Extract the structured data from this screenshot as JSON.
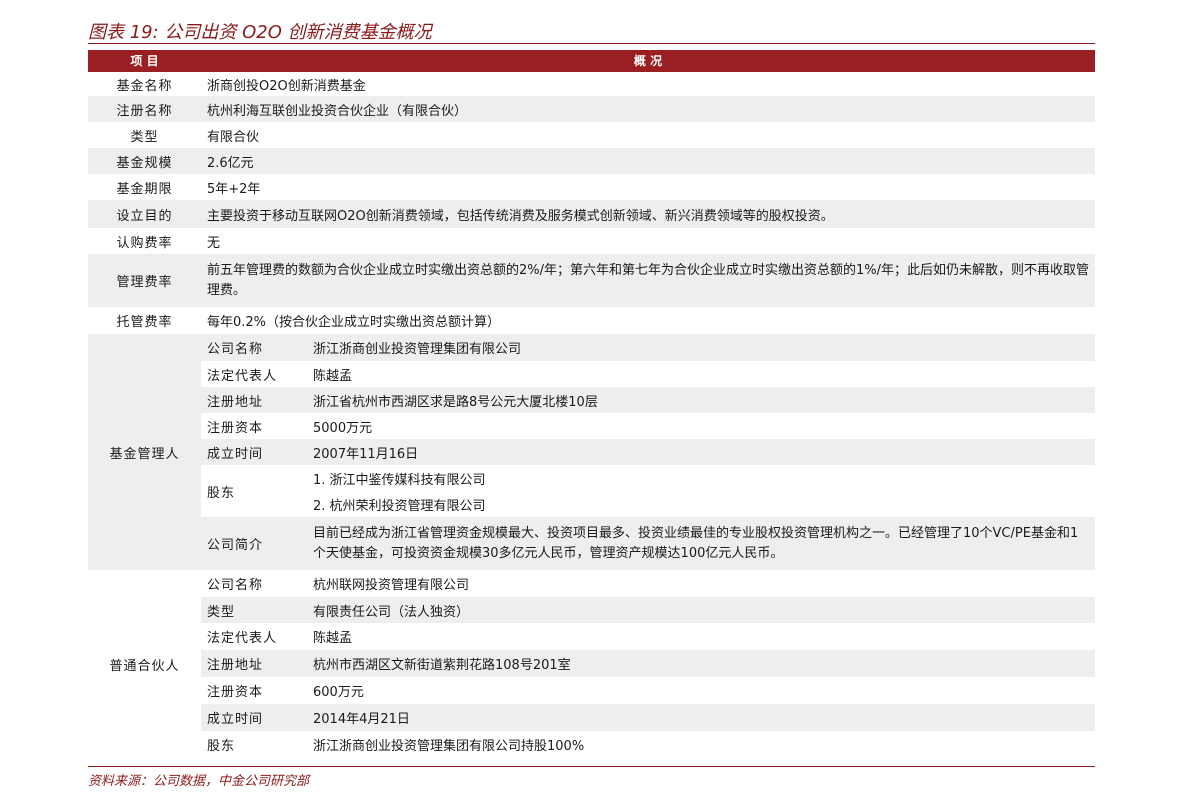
{
  "title": "图表 19: 公司出资 O2O 创新消费基金概况",
  "header": {
    "col1": "项 目",
    "col2": "概 况"
  },
  "rows": [
    {
      "label": "基金名称",
      "value": "浙商创投O2O创新消费基金"
    },
    {
      "label": "注册名称",
      "value": "杭州利海互联创业投资合伙企业（有限合伙）"
    },
    {
      "label": "类型",
      "value": "有限合伙"
    },
    {
      "label": "基金规模",
      "value": "2.6亿元"
    },
    {
      "label": "基金期限",
      "value": "5年+2年"
    },
    {
      "label": "设立目的",
      "value": "主要投资于移动互联网O2O创新消费领域，包括传统消费及服务模式创新领域、新兴消费领域等的股权投资。"
    },
    {
      "label": "认购费率",
      "value": "无"
    },
    {
      "label": "管理费率",
      "value": "前五年管理费的数额为合伙企业成立时实缴出资总额的2%/年；第六年和第七年为合伙企业成立时实缴出资总额的1%/年；此后如仍未解散，则不再收取管理费。"
    },
    {
      "label": "托管费率",
      "value": "每年0.2%（按合伙企业成立时实缴出资总额计算）"
    }
  ],
  "manager": {
    "label": "基金管理人",
    "items": [
      {
        "label": "公司名称",
        "value": "浙江浙商创业投资管理集团有限公司"
      },
      {
        "label": "法定代表人",
        "value": "陈越孟"
      },
      {
        "label": "注册地址",
        "value": "浙江省杭州市西湖区求是路8号公元大厦北楼10层"
      },
      {
        "label": "注册资本",
        "value": "5000万元"
      },
      {
        "label": "成立时间",
        "value": "2007年11月16日"
      },
      {
        "label": "股东",
        "value1": "1. 浙江中鉴传媒科技有限公司",
        "value2": "2. 杭州荣利投资管理有限公司"
      },
      {
        "label": "公司简介",
        "value": "目前已经成为浙江省管理资金规模最大、投资项目最多、投资业绩最佳的专业股权投资管理机构之一。已经管理了10个VC/PE基金和1个天使基金，可投资资金规模30多亿元人民币，管理资产规模达100亿元人民币。"
      }
    ]
  },
  "gp": {
    "label": "普通合伙人",
    "items": [
      {
        "label": "公司名称",
        "value": "杭州联网投资管理有限公司"
      },
      {
        "label": "类型",
        "value": "有限责任公司（法人独资）"
      },
      {
        "label": "法定代表人",
        "value": "陈越孟"
      },
      {
        "label": "注册地址",
        "value": "杭州市西湖区文新街道紫荆花路108号201室"
      },
      {
        "label": "注册资本",
        "value": "600万元"
      },
      {
        "label": "成立时间",
        "value": "2014年4月21日"
      },
      {
        "label": "股东",
        "value": "浙江浙商创业投资管理集团有限公司持股100%"
      }
    ]
  },
  "source": "资料来源：公司数据，中金公司研究部",
  "colors": {
    "accent": "#9a1f22",
    "shade": "#eeeeee"
  }
}
